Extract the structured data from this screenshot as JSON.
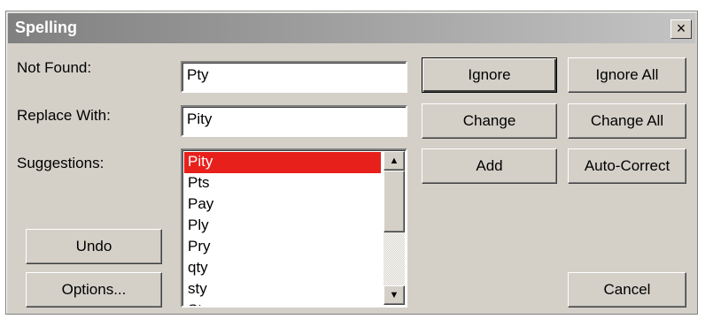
{
  "window": {
    "title": "Spelling",
    "close_glyph": "×"
  },
  "fields": {
    "not_found_label": "Not Found:",
    "not_found_value": "Pty",
    "replace_with_label": "Replace With:",
    "replace_with_value": "Pity",
    "suggestions_label": "Suggestions:"
  },
  "suggestions": {
    "items": [
      "Pity",
      "Pts",
      "Pay",
      "Ply",
      "Pry",
      "qty",
      "sty",
      "St"
    ],
    "selected": "Pity"
  },
  "buttons": {
    "ignore": "Ignore",
    "ignore_all": "Ignore All",
    "change": "Change",
    "change_all": "Change All",
    "add": "Add",
    "auto_correct": "Auto-Correct",
    "undo": "Undo",
    "options": "Options...",
    "cancel": "Cancel"
  },
  "icons": {
    "scroll_up": "triangle-up-icon",
    "scroll_down": "triangle-down-icon"
  },
  "colors": {
    "selection": "#e8201c",
    "dialog_bg": "#d4d0c8"
  }
}
